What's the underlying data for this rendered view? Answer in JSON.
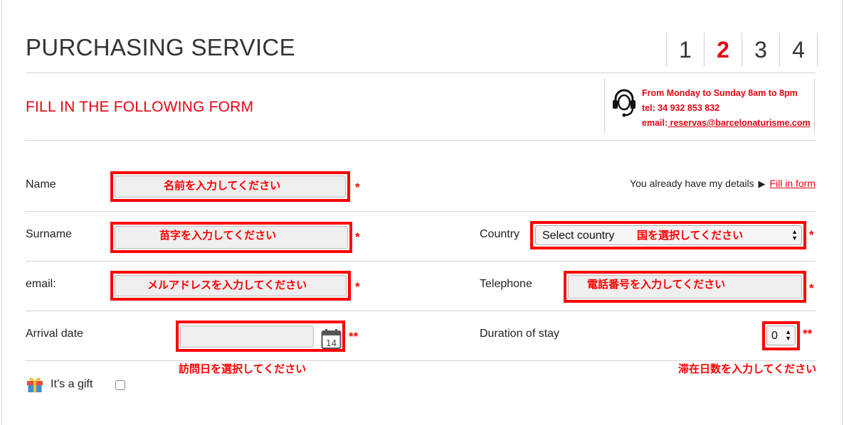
{
  "header": {
    "title": "PURCHASING SERVICE",
    "steps": [
      "1",
      "2",
      "3",
      "4"
    ],
    "active_step": "2"
  },
  "subtitle": "FILL IN THE FOLLOWING FORM",
  "contact": {
    "hours": "From Monday to Sunday 8am to 8pm",
    "tel": "tel: 34 932 853 832",
    "email_label": "email:",
    "email": " reservas@barcelonaturisme.com",
    "icon": "headset-icon"
  },
  "form": {
    "name": {
      "label": "Name",
      "value": "",
      "annotation": "名前を入力してください",
      "required": "*"
    },
    "surname": {
      "label": "Surname",
      "value": "",
      "annotation": "苗字を入力してください",
      "required": "*"
    },
    "email": {
      "label": "email:",
      "value": "",
      "annotation": "メルアドレスを入力してください",
      "required": "*"
    },
    "arrival_date": {
      "label": "Arrival date",
      "value": "",
      "annotation": "訪問日を選択してください",
      "required": "**",
      "calendar_number": "14"
    },
    "country": {
      "label": "Country",
      "selected": "Select country",
      "annotation": "国を選択してください",
      "required": "*"
    },
    "telephone": {
      "label": "Telephone",
      "value": "",
      "annotation": "電話番号を入力してください",
      "required": "*"
    },
    "duration": {
      "label": "Duration of stay",
      "selected": "0",
      "annotation": "滞在日数を入力してください",
      "required": "**"
    },
    "gift": {
      "label": "It’s a gift",
      "checked": false
    }
  },
  "details": {
    "text": "You already have my details",
    "arrow": "▶",
    "link": "Fill in form"
  },
  "colors": {
    "brand_red": "#e30613",
    "annotation_red": "#ff0000"
  }
}
